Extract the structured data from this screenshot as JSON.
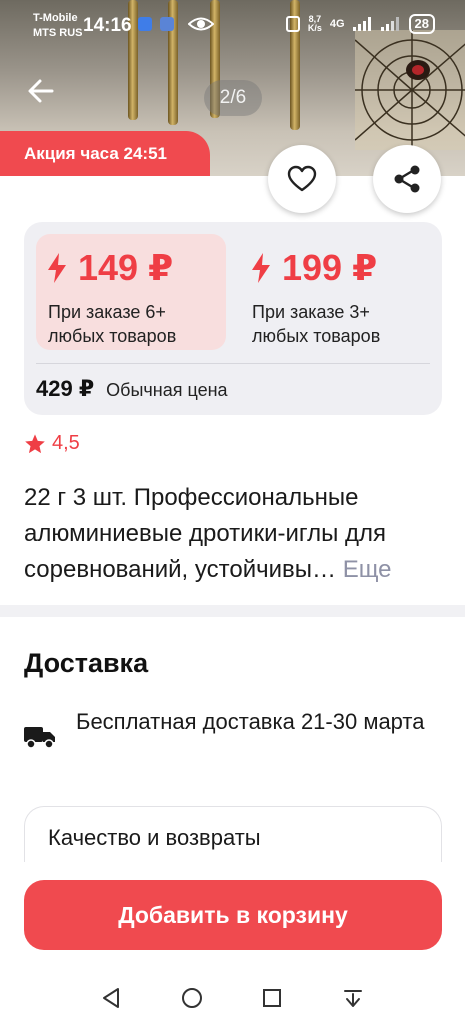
{
  "status_bar": {
    "carrier_line1": "T-Mobile",
    "carrier_line2": "MTS RUS",
    "time": "14:16",
    "net_speed_top": "8,7",
    "net_speed_bottom": "K/s",
    "network": "4G",
    "battery": "28"
  },
  "gallery": {
    "counter": "2/6",
    "promo_label": "Акция часа 24:51"
  },
  "pricing": {
    "tiers": [
      {
        "price": "149 ₽",
        "condition": "При заказе 6+ любых товаров",
        "highlighted": true
      },
      {
        "price": "199 ₽",
        "condition": "При заказе 3+ любых товаров",
        "highlighted": false
      }
    ],
    "regular_price": "429 ₽",
    "regular_label": "Обычная цена"
  },
  "rating": {
    "value": "4,5"
  },
  "product": {
    "title": "22 г 3 шт. Профессиональные алюминиевые дротики-иглы для соревнований, устойчивы…",
    "more_label": "Еще"
  },
  "delivery": {
    "heading": "Доставка",
    "text": "Бесплатная доставка 21-30 марта"
  },
  "returns": {
    "label": "Качество и возвраты"
  },
  "actions": {
    "add_to_cart": "Добавить в корзину"
  },
  "colors": {
    "accent": "#f04a4f",
    "price": "#ef3e45",
    "tier_bg": "#f8dede",
    "card_bg": "#efeff3"
  }
}
